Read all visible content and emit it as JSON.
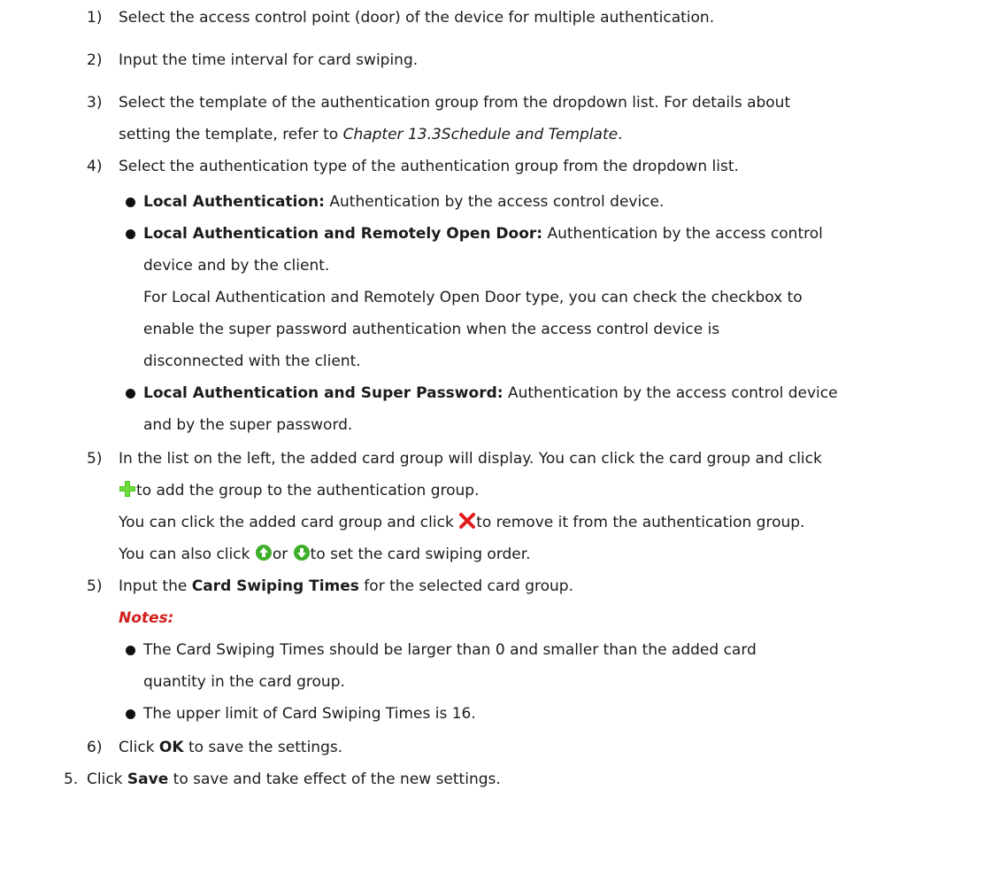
{
  "steps": {
    "s1": {
      "num": "1)",
      "text": "Select the access control point (door) of the device for multiple authentication."
    },
    "s2": {
      "num": "2)",
      "text": "Input the time interval for card swiping."
    },
    "s3": {
      "num": "3)",
      "line1": "Select the template of the authentication group from the dropdown list. For details about",
      "line2_prefix": "setting the template, refer to ",
      "line2_ref": "Chapter 13.3Schedule and Template",
      "line2_suffix": "."
    },
    "s4": {
      "num": "4)",
      "text": "Select the authentication type of the authentication group from the dropdown list.",
      "b1_title": "Local Authentication:",
      "b1_text": " Authentication by the access control device.",
      "b2_title": "Local Authentication and Remotely Open Door:",
      "b2_text1": " Authentication by the access control",
      "b2_text2": "device and by the client.",
      "b2_para1": "For Local Authentication and Remotely Open Door type, you can check the checkbox to",
      "b2_para2": "enable the super password authentication when the access control device is",
      "b2_para3": "disconnected with the client.",
      "b3_title": "Local Authentication and Super Password:",
      "b3_text1": " Authentication by the access control device",
      "b3_text2": "and by the super password."
    },
    "s5a": {
      "num": "5)",
      "line1": "In the list on the left, the added card group will display. You can click the card group and click",
      "line2": "to add the group to the authentication group.",
      "line3_pre": "You can click the added card group and click ",
      "line3_post": "to remove it from the authentication group.",
      "line4_pre": "You can also click ",
      "line4_or": "or ",
      "line4_post": "to set the card swiping order."
    },
    "s5b": {
      "num": "5)",
      "pre": "Input the ",
      "bold": "Card Swiping Times",
      "post": " for the selected card group.",
      "notes_label": "Notes:",
      "n1_line1": "The Card Swiping Times should be larger than 0 and smaller than the added card",
      "n1_line2": "quantity in the card group.",
      "n2": "The upper limit of Card Swiping Times is 16."
    },
    "s6": {
      "num": "6)",
      "pre": "Click ",
      "bold": "OK",
      "post": " to save the settings."
    },
    "s7": {
      "num": "5.",
      "pre": "Click ",
      "bold": "Save",
      "post": " to save and take effect of the new settings."
    }
  },
  "icons": {
    "add": "plus-icon",
    "remove": "x-icon",
    "up": "arrow-up-circle-icon",
    "down": "arrow-down-circle-icon",
    "add_color": "#4cc21f",
    "remove_color": "#e11c1c",
    "updown_color": "#3fae2a"
  }
}
